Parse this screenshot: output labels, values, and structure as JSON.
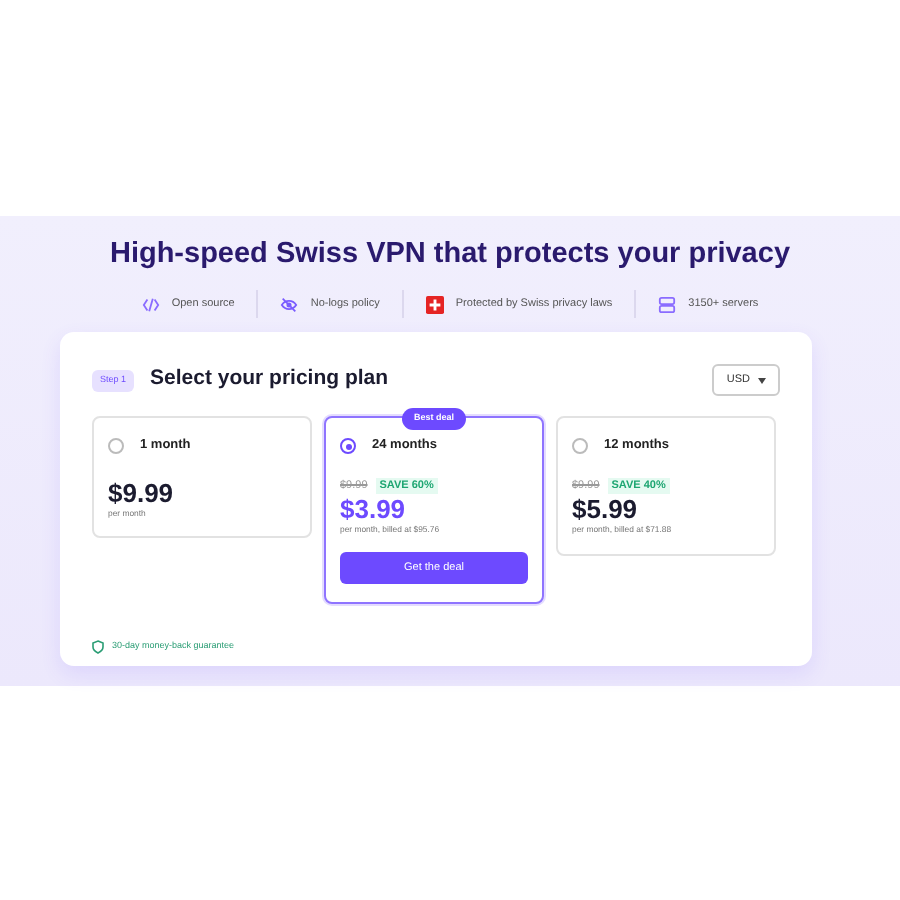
{
  "title": "High-speed Swiss VPN that protects your privacy",
  "features": [
    {
      "kind": "code",
      "label": "Open source"
    },
    {
      "kind": "eye",
      "label": "No-logs policy"
    },
    {
      "kind": "flag",
      "label": "Protected by Swiss privacy laws"
    },
    {
      "kind": "server",
      "label": "3150+ servers"
    }
  ],
  "step": "Step 1",
  "heading": "Select your pricing plan",
  "currency": "USD",
  "plans": [
    {
      "name": "1 month",
      "selected": false,
      "price": "$9.99",
      "note": "per month"
    },
    {
      "name": "24 months",
      "selected": true,
      "badge": "Best deal",
      "old_price": "$9.99",
      "save": "SAVE 60%",
      "price": "$3.99",
      "note": "per month, billed at $95.76",
      "button": "Get the deal"
    },
    {
      "name": "12 months",
      "selected": false,
      "old_price": "$9.99",
      "save": "SAVE 40%",
      "price": "$5.99",
      "note": "per month, billed at $71.88"
    }
  ],
  "guarantee": "30-day money-back guarantee"
}
